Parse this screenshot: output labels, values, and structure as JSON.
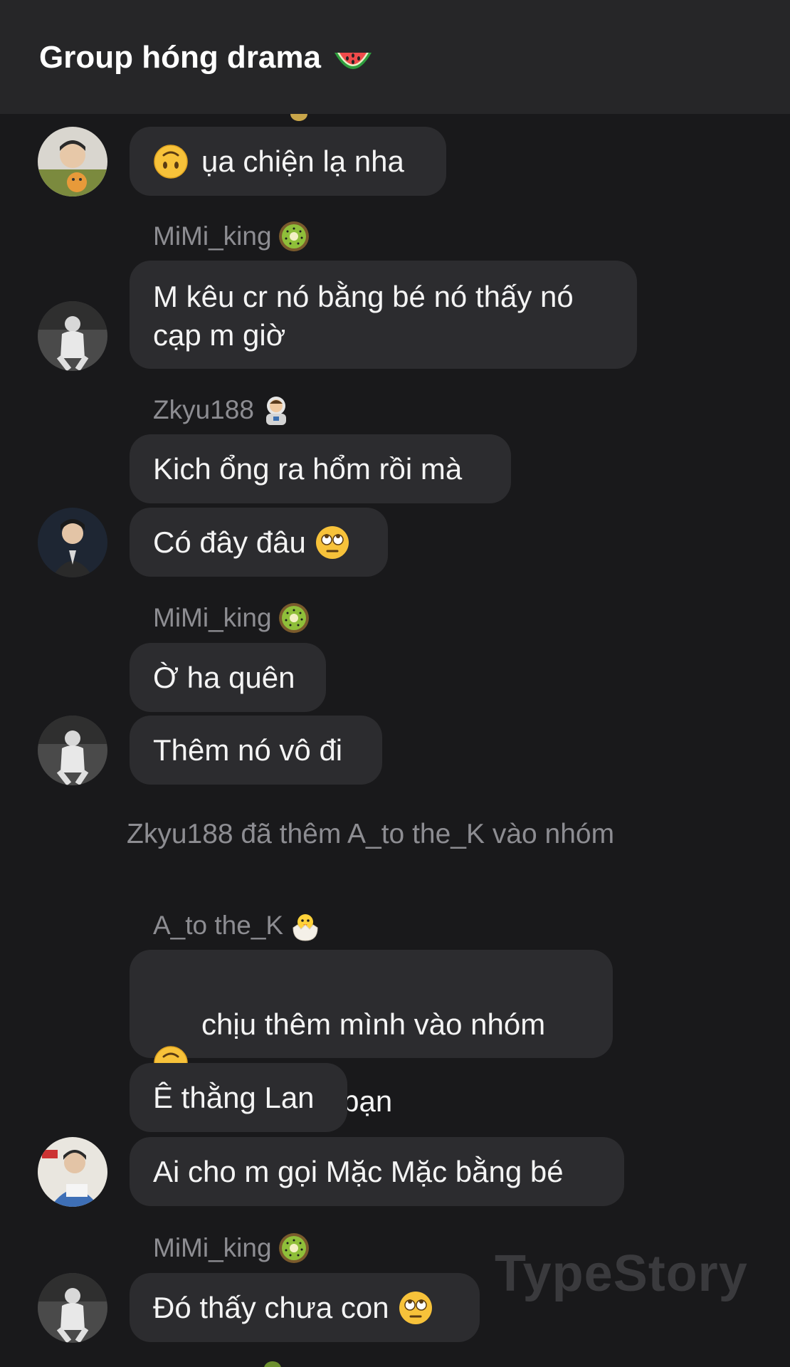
{
  "header": {
    "title": "Group hóng drama",
    "emoji": "watermelon-icon"
  },
  "messages": [
    {
      "text": "ụa chiện lạ nha",
      "lead_emoji": "upside-down-face-icon"
    },
    {
      "sender": "MiMi_king",
      "sender_emoji": "kiwi-icon",
      "text": "M kêu cr nó bằng bé nó thấy nó\ncạp m giờ"
    },
    {
      "sender": "Zkyu188",
      "sender_emoji": "astronaut-icon",
      "text": "Kich ổng ra hổm rồi mà"
    },
    {
      "text": "Có đây đâu",
      "trail_emoji": "eye-roll-icon"
    },
    {
      "sender": "MiMi_king",
      "sender_emoji": "kiwi-icon",
      "text": "Ờ ha quên"
    },
    {
      "text": "Thêm nó vô đi"
    },
    {
      "sender": "A_to the_K",
      "sender_emoji": "hatching-chick-icon",
      "line1": "chịu thêm mình vào nhóm",
      "line2": "rồi đó hả mấy bạn",
      "lead_emoji": "upside-down-face-icon"
    },
    {
      "text": "Ê thằng Lan"
    },
    {
      "text": "Ai cho m gọi Mặc Mặc bằng bé"
    },
    {
      "sender": "MiMi_king",
      "sender_emoji": "kiwi-icon",
      "text": "Đó thấy chưa con",
      "trail_emoji": "eye-roll-icon"
    }
  ],
  "system_notice": "Zkyu188 đã thêm A_to the_K vào nhóm",
  "watermark": "TypeStory",
  "colors": {
    "background": "#19191b",
    "header": "#262628",
    "bubble": "#2c2c2f",
    "muted_text": "#8d8d92"
  }
}
